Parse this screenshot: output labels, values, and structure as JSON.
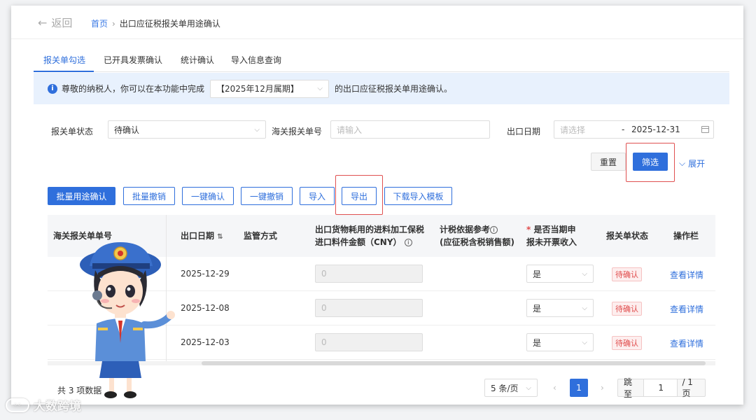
{
  "header": {
    "back_label": "返回",
    "breadcrumb_home": "首页",
    "breadcrumb_sep": "›",
    "breadcrumb_current": "出口应征税报关单用途确认"
  },
  "tabs": [
    {
      "label": "报关单勾选",
      "active": true
    },
    {
      "label": "已开具发票确认",
      "active": false
    },
    {
      "label": "统计确认",
      "active": false
    },
    {
      "label": "导入信息查询",
      "active": false
    }
  ],
  "notice": {
    "icon": "info-icon",
    "prefix": "尊敬的纳税人，你可以在本功能中完成",
    "period_value": "【2025年12月属期】",
    "suffix": "的出口应征税报关单用途确认。"
  },
  "filters": {
    "status_label": "报关单状态",
    "status_value": "待确认",
    "customs_no_label": "海关报关单号",
    "customs_no_placeholder": "请输入",
    "export_date_label": "出口日期",
    "date_start_placeholder": "请选择",
    "date_sep": "-",
    "date_end_value": "2025-12-31"
  },
  "filter_actions": {
    "reset": "重置",
    "filter": "筛选",
    "expand": "展开"
  },
  "toolbar": {
    "batch_confirm": "批量用途确认",
    "batch_revoke": "批量撤销",
    "one_click_confirm": "一键确认",
    "one_click_revoke": "一键撤销",
    "import": "导入",
    "export": "导出",
    "download_template": "下载导入模板"
  },
  "table": {
    "headers": {
      "customs_no": "海关报关单单号",
      "export_date": "出口日期",
      "supervision": "监管方式",
      "amount_line1": "出口货物耗用的进料加工保税",
      "amount_line2": "进口料件金额（CNY）",
      "tax_basis_line1": "计税依据参考",
      "tax_basis_line2": "(应征税含税销售额)",
      "current_period_line1": "是否当期申",
      "current_period_line2": "报未开票收入",
      "status": "报关单状态",
      "actions": "操作栏"
    },
    "rows": [
      {
        "export_date": "2025-12-29",
        "amount": "0",
        "current_period": "是",
        "status": "待确认",
        "action": "查看详情"
      },
      {
        "export_date": "2025-12-08",
        "amount": "0",
        "current_period": "是",
        "status": "待确认",
        "action": "查看详情"
      },
      {
        "export_date": "2025-12-03",
        "amount": "0",
        "current_period": "是",
        "status": "待确认",
        "action": "查看详情"
      }
    ]
  },
  "pagination": {
    "total": "共 3 项数据",
    "page_size": "5 条/页",
    "prev": "‹",
    "current": "1",
    "next": "›",
    "jump_label": "跳至",
    "jump_value": "1",
    "total_pages": "/ 1 页"
  },
  "watermark": {
    "text": "大数跨境"
  },
  "colors": {
    "primary": "#2f6fdc",
    "notice_bg": "#e8f1fd",
    "highlight_box": "#e05050",
    "status_tag": "#e04b4b"
  }
}
